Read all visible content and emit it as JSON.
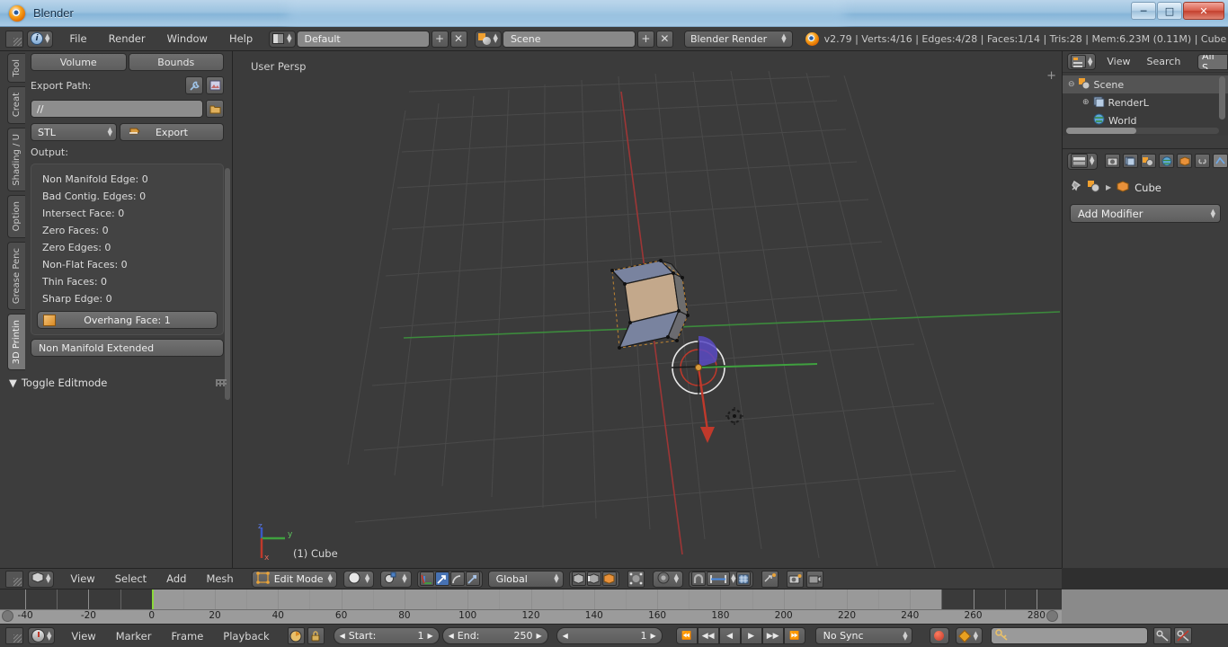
{
  "window": {
    "title": "Blender",
    "buttons": {
      "minimize": "–",
      "maximize": "□",
      "close": "✕"
    }
  },
  "topbar": {
    "menus": [
      "File",
      "Render",
      "Window",
      "Help"
    ],
    "screen_layout": "Default",
    "scene_name": "Scene",
    "render_engine": "Blender Render",
    "stats": "v2.79 | Verts:4/16 | Edges:4/28 | Faces:1/14 | Tris:28 | Mem:6.23M (0.11M) | Cube"
  },
  "toolshelf": {
    "tabs": [
      {
        "label": "Tool",
        "active": false
      },
      {
        "label": "Creat",
        "active": false
      },
      {
        "label": "Shading / U",
        "active": false
      },
      {
        "label": "Option",
        "active": false
      },
      {
        "label": "Grease Penc",
        "active": false
      },
      {
        "label": "3D Printin",
        "active": true
      }
    ],
    "segment_buttons": [
      "Volume",
      "Bounds"
    ],
    "export_path_label": "Export Path:",
    "export_path_value": "//",
    "format": "STL",
    "export_button": "Export",
    "output_label": "Output:",
    "stats": [
      "Non Manifold Edge: 0",
      "Bad Contig. Edges: 0",
      "Intersect Face: 0",
      "Zero Faces: 0",
      "Zero Edges: 0",
      "Non-Flat Faces: 0",
      "Thin Faces: 0",
      "Sharp Edge: 0"
    ],
    "overhang": "Overhang Face: 1",
    "non_manifold_extended": "Non Manifold Extended",
    "toggle_editmode": "Toggle Editmode"
  },
  "viewport": {
    "perspective_label": "User Persp",
    "object_label": "(1) Cube",
    "axis_x": "x",
    "axis_y": "y",
    "axis_z": "z",
    "colors": {
      "background": "#3b3b3b",
      "axis_x_line": "#c0392b",
      "axis_y_line": "#3fa03f",
      "face_selected": "#7b84ac",
      "face_active": "#c6a98c"
    }
  },
  "outliner": {
    "menus": [
      "View",
      "Search"
    ],
    "display_mode": "All S",
    "rows": [
      {
        "label": "Scene",
        "indent": 0,
        "selected": true
      },
      {
        "label": "RenderL",
        "indent": 1,
        "selected": false
      },
      {
        "label": "World",
        "indent": 1,
        "selected": false
      }
    ]
  },
  "properties": {
    "breadcrumb": "Cube",
    "add_modifier": "Add Modifier"
  },
  "viewport_toolbar": {
    "menus": [
      "View",
      "Select",
      "Add",
      "Mesh"
    ],
    "mode": "Edit Mode",
    "orientation": "Global"
  },
  "timeline": {
    "ticks": [
      -40,
      -20,
      0,
      20,
      40,
      60,
      80,
      100,
      120,
      140,
      160,
      180,
      200,
      220,
      240,
      260,
      280
    ],
    "range_start": -48,
    "range_end": 288,
    "playhead_frame": 0,
    "frame_start_limit": 0,
    "frame_end_limit": 250
  },
  "bottombar": {
    "menus": [
      "View",
      "Marker",
      "Frame",
      "Playback"
    ],
    "start_label": "Start:",
    "start_value": "1",
    "end_label": "End:",
    "end_value": "250",
    "current_frame": "1",
    "sync_mode": "No Sync"
  }
}
